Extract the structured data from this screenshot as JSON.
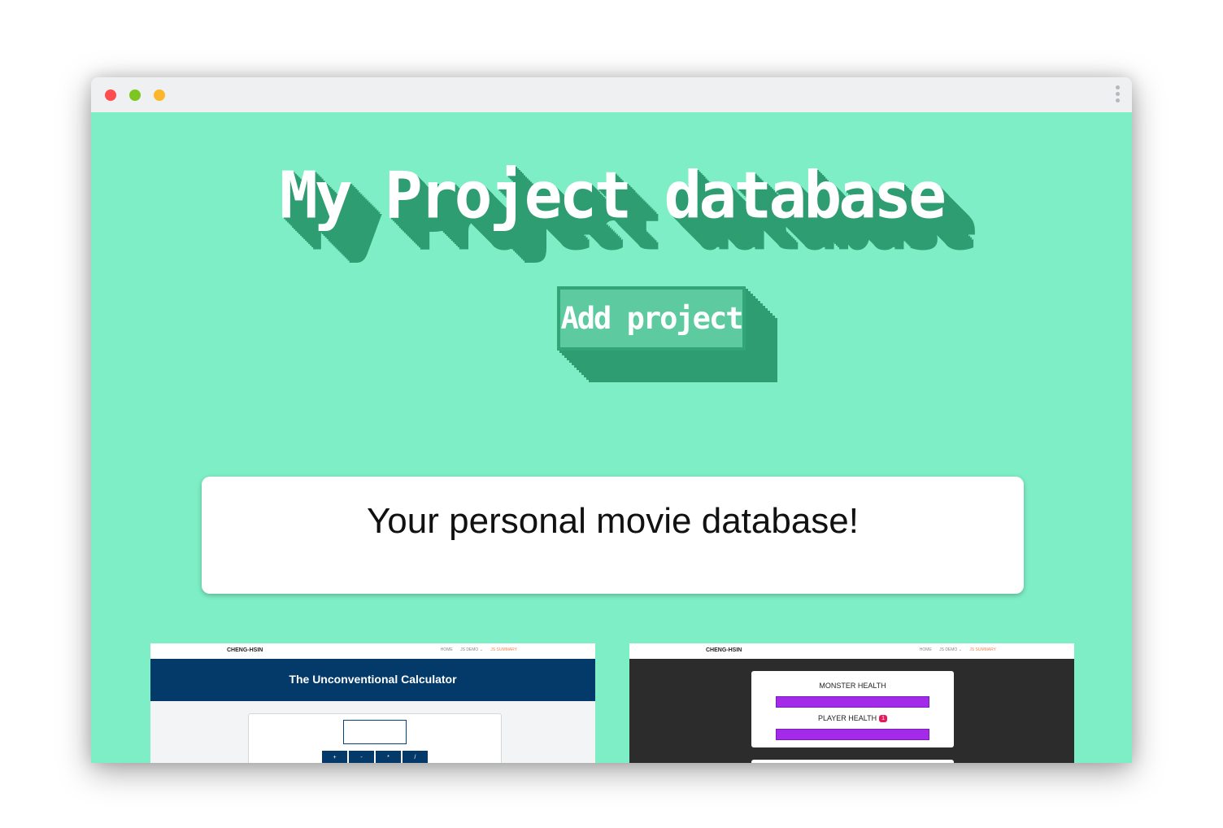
{
  "page": {
    "title": "My Project database",
    "add_button_label": "Add project",
    "info_text": "Your personal movie database!"
  },
  "colors": {
    "background": "#7deec5",
    "shadow": "#2f9d72",
    "button": "#5dcb9f",
    "calc_header": "#043a6a",
    "health_bar": "#a22ae8"
  },
  "window_controls": {
    "close_icon": "red-dot",
    "minimize_icon": "green-dot",
    "maximize_icon": "yellow-dot",
    "menu_icon": "kebab-icon"
  },
  "projects": [
    {
      "nav_logo": "CHENG-HSIN",
      "nav_links": [
        "HOME",
        "JS DEMO ⌄",
        "JS SUMMARY"
      ],
      "title": "The Unconventional Calculator",
      "buttons": [
        "+",
        "-",
        "*",
        "/"
      ]
    },
    {
      "nav_logo": "CHENG-HSIN",
      "nav_links": [
        "HOME",
        "JS DEMO ⌄",
        "JS SUMMARY"
      ],
      "monster_label": "MONSTER HEALTH",
      "player_label": "PLAYER HEALTH",
      "player_badge": "1"
    }
  ]
}
